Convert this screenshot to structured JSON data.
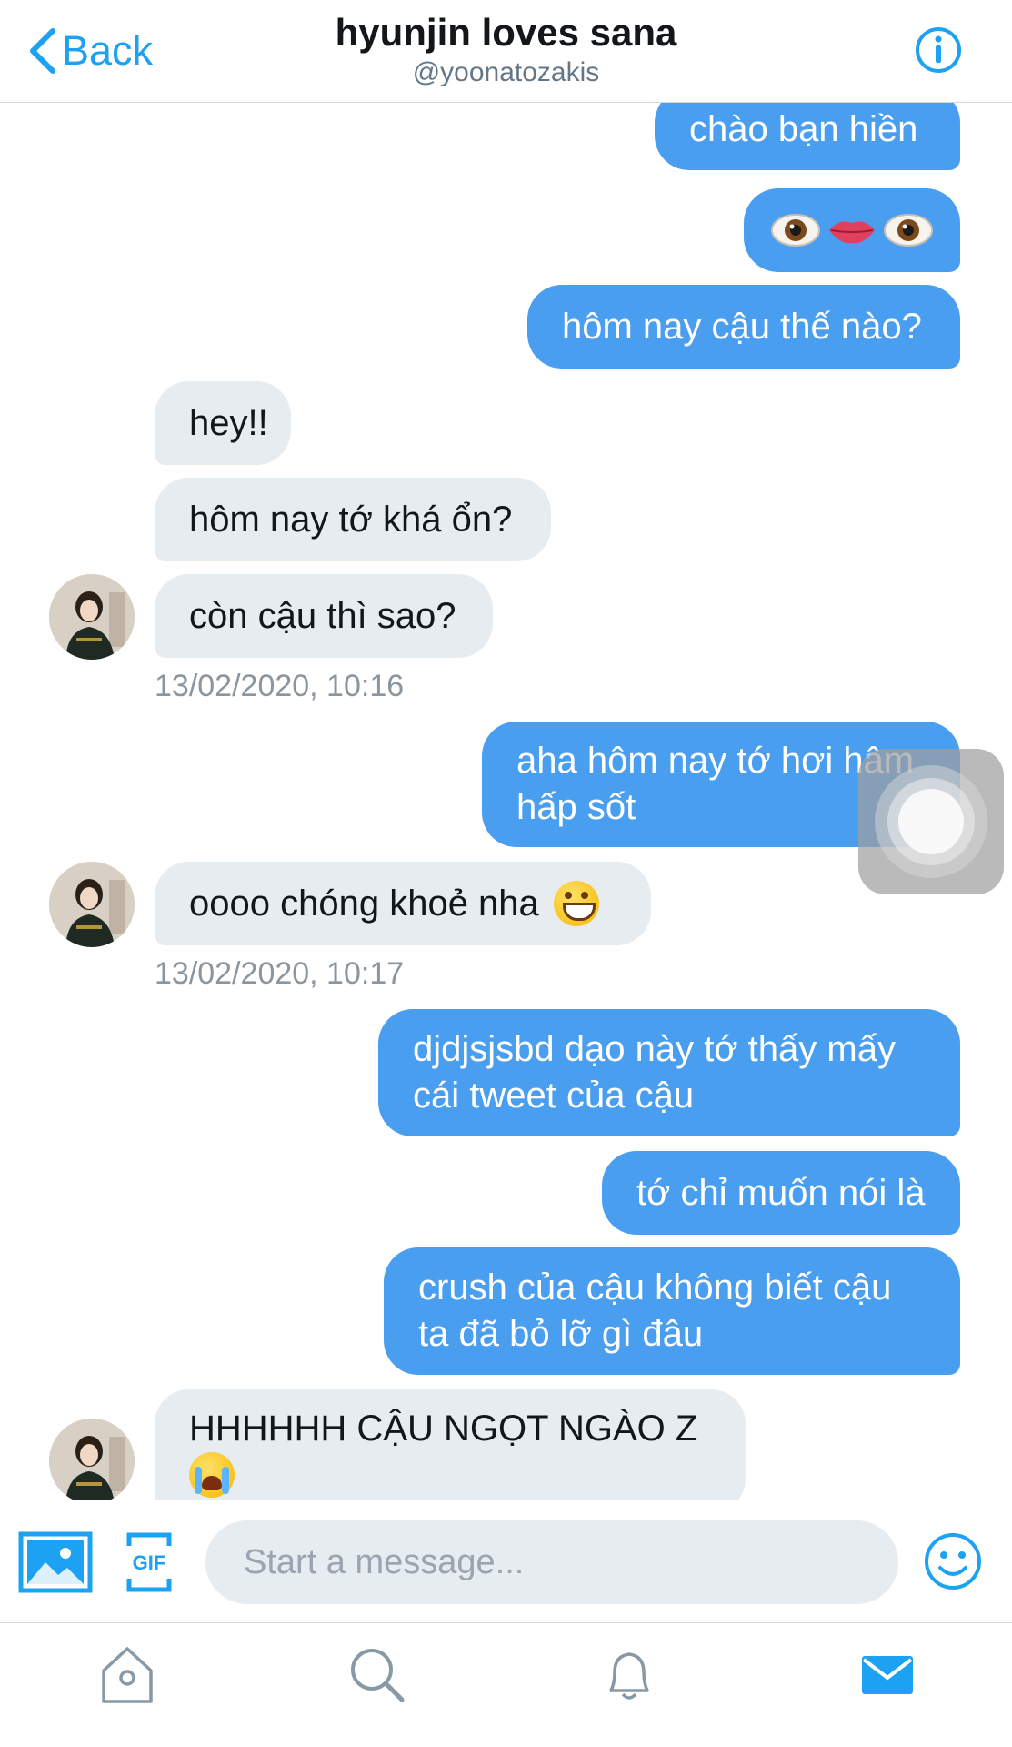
{
  "header": {
    "back_label": "Back",
    "title": "hyunjin loves sana",
    "handle": "@yoonatozakis",
    "info_icon": "info-circle-icon"
  },
  "colors": {
    "accent": "#1da1f2",
    "outgoing_bubble": "#4a9ef0",
    "incoming_bubble": "#e6ecf0",
    "timestamp": "#8a959e"
  },
  "messages": [
    {
      "direction": "out",
      "text": "chào bạn hiền"
    },
    {
      "direction": "out",
      "text": "👁💋👁",
      "icons": [
        "eye-emoji-icon",
        "lips-emoji-icon",
        "eye-emoji-icon"
      ]
    },
    {
      "direction": "out",
      "text": "hôm nay cậu thế nào?"
    },
    {
      "direction": "in",
      "text": "hey!!"
    },
    {
      "direction": "in",
      "text": "hôm nay tớ khá ổn?"
    },
    {
      "direction": "in",
      "text": "còn cậu thì sao?"
    },
    {
      "direction": "out",
      "text": "aha hôm nay tớ hơi hâm\nhấp sốt"
    },
    {
      "direction": "in",
      "text": "oooo chóng khoẻ nha",
      "emoji": "grinning-face-icon"
    },
    {
      "direction": "out",
      "text": "djdjsjsbd dạo này tớ thấy mấy\ncái tweet của cậu"
    },
    {
      "direction": "out",
      "text": "tớ chỉ muốn nói là"
    },
    {
      "direction": "out",
      "text": "crush của cậu không biết cậu\nta đã bỏ lỡ gì đâu"
    },
    {
      "direction": "in",
      "text": "HHHHHH CẬU NGỌT NGÀO Z",
      "emoji": "loudly-crying-face-icon"
    }
  ],
  "timestamps": [
    "13/02/2020, 10:16",
    "13/02/2020, 10:17"
  ],
  "composer": {
    "placeholder": "Start a message...",
    "media_icon": "image-icon",
    "gif_label": "GIF",
    "emoji_icon": "smiley-icon"
  },
  "tabbar": {
    "items": [
      "home-icon",
      "search-icon",
      "bell-icon",
      "mail-icon"
    ],
    "active": "mail-icon"
  }
}
